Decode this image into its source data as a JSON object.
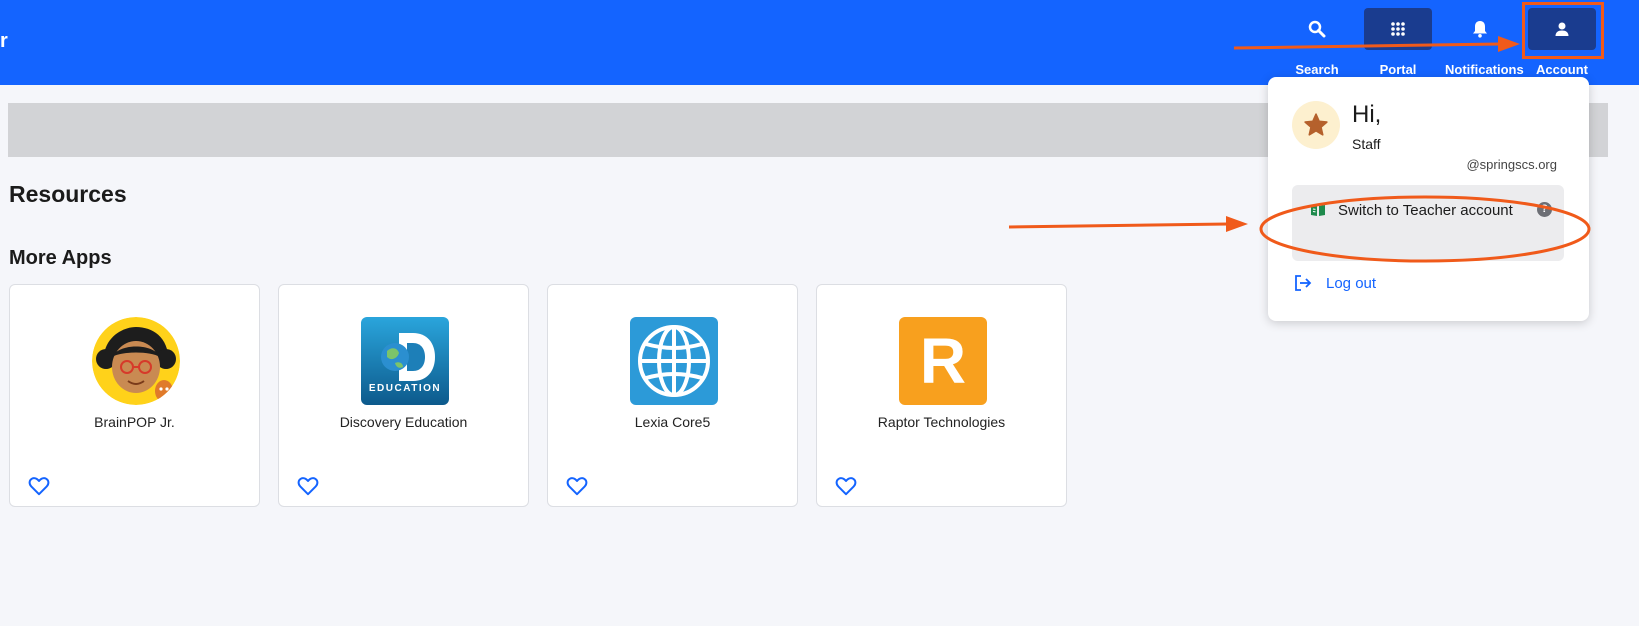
{
  "header": {
    "brand_fragment": "r",
    "nav": [
      {
        "label": "Search",
        "icon": "search-icon"
      },
      {
        "label": "Portal",
        "icon": "grid-icon"
      },
      {
        "label": "Notifications",
        "icon": "bell-icon"
      },
      {
        "label": "Account",
        "icon": "user-icon"
      }
    ]
  },
  "main": {
    "resources_heading": "Resources",
    "more_apps_heading": "More Apps",
    "apps": [
      {
        "name": "BrainPOP Jr.",
        "logo": "brainpop-jr-logo"
      },
      {
        "name": "Discovery Education",
        "logo": "discovery-education-logo",
        "logo_text": "EDUCATION"
      },
      {
        "name": "Lexia Core5",
        "logo": "globe-logo"
      },
      {
        "name": "Raptor Technologies",
        "logo": "raptor-logo",
        "logo_text": "R"
      }
    ]
  },
  "account_menu": {
    "greeting": "Hi,",
    "role": "Staff",
    "email": "@springscs.org",
    "switch_label": "Switch to Teacher account",
    "logout_label": "Log out"
  },
  "colors": {
    "header_blue": "#1464ff",
    "active_nav": "#1a3c8f",
    "annotation_orange": "#f05a1a",
    "heart_blue": "#1464ff"
  }
}
